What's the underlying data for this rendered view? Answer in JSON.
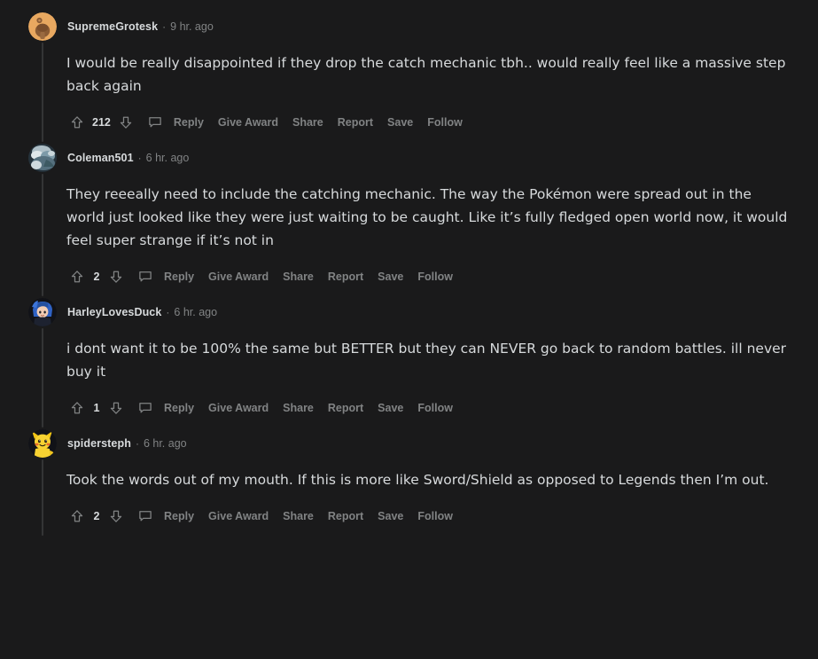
{
  "theme": {
    "background": "#1a1a1b",
    "text_primary": "#d7dadc",
    "text_muted": "#818384",
    "thread_line": "#343536"
  },
  "comments": [
    {
      "username": "SupremeGrotesk",
      "separator": "·",
      "timestamp": "9 hr. ago",
      "body": "I would be really disappointed if they drop the catch mechanic tbh.. would really feel like a massive step back again",
      "score": "212",
      "avatar": "snoo-orange-avatar",
      "actions": {
        "upvote_icon": "upvote-arrow-icon",
        "downvote_icon": "downvote-arrow-icon",
        "comment_icon": "comment-bubble-icon",
        "reply": "Reply",
        "give_award": "Give Award",
        "share": "Share",
        "report": "Report",
        "save": "Save",
        "follow": "Follow"
      }
    },
    {
      "username": "Coleman501",
      "separator": "·",
      "timestamp": "6 hr. ago",
      "body": "They reeeally need to include the catching mechanic. The way the Pokémon were spread out in the world just looked like they were just waiting to be caught. Like it’s fully fledged open world now, it would feel super strange if it’s not in",
      "score": "2",
      "avatar": "photo-avatar",
      "actions": {
        "upvote_icon": "upvote-arrow-icon",
        "downvote_icon": "downvote-arrow-icon",
        "comment_icon": "comment-bubble-icon",
        "reply": "Reply",
        "give_award": "Give Award",
        "share": "Share",
        "report": "Report",
        "save": "Save",
        "follow": "Follow"
      }
    },
    {
      "username": "HarleyLovesDuck",
      "separator": "·",
      "timestamp": "6 hr. ago",
      "body": "i dont want it to be 100% the same but BETTER but they can NEVER go back to random battles. ill never buy it",
      "score": "1",
      "avatar": "blue-hair-character-avatar",
      "actions": {
        "upvote_icon": "upvote-arrow-icon",
        "downvote_icon": "downvote-arrow-icon",
        "comment_icon": "comment-bubble-icon",
        "reply": "Reply",
        "give_award": "Give Award",
        "share": "Share",
        "report": "Report",
        "save": "Save",
        "follow": "Follow"
      }
    },
    {
      "username": "spidersteph",
      "separator": "·",
      "timestamp": "6 hr. ago",
      "body": "Took the words out of my mouth. If this is more like Sword/Shield as opposed to Legends then I’m out.",
      "score": "2",
      "avatar": "yellow-character-avatar",
      "actions": {
        "upvote_icon": "upvote-arrow-icon",
        "downvote_icon": "downvote-arrow-icon",
        "comment_icon": "comment-bubble-icon",
        "reply": "Reply",
        "give_award": "Give Award",
        "share": "Share",
        "report": "Report",
        "save": "Save",
        "follow": "Follow"
      }
    }
  ]
}
